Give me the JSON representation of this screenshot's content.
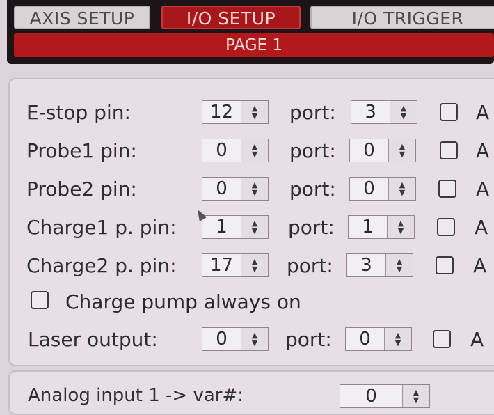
{
  "tabs": [
    {
      "label": "AXIS SETUP",
      "active": false
    },
    {
      "label": "I/O SETUP",
      "active": true
    },
    {
      "label": "I/O TRIGGER",
      "active": false
    }
  ],
  "page_indicator": "PAGE 1",
  "io_rows": [
    {
      "label": "E-stop pin:",
      "pin": "12",
      "port_label": "port:",
      "port": "3",
      "check_text": "A"
    },
    {
      "label": "Probe1 pin:",
      "pin": "0",
      "port_label": "port:",
      "port": "0",
      "check_text": "A"
    },
    {
      "label": "Probe2 pin:",
      "pin": "0",
      "port_label": "port:",
      "port": "0",
      "check_text": "A"
    },
    {
      "label": "Charge1 p. pin:",
      "pin": "1",
      "port_label": "port:",
      "port": "1",
      "check_text": "A"
    },
    {
      "label": "Charge2 p. pin:",
      "pin": "17",
      "port_label": "port:",
      "port": "3",
      "check_text": "A"
    }
  ],
  "charge_pump": {
    "label": "Charge pump always on",
    "checked": false
  },
  "laser": {
    "label": "Laser output:",
    "pin": "0",
    "port_label": "port:",
    "port": "0",
    "check_text": "A"
  },
  "analog": {
    "label": "Analog input 1 -> var#:",
    "value": "0"
  },
  "colors": {
    "accent": "#b3181b",
    "panel": "#e8dfe6",
    "dark_bar": "#1c1416"
  }
}
